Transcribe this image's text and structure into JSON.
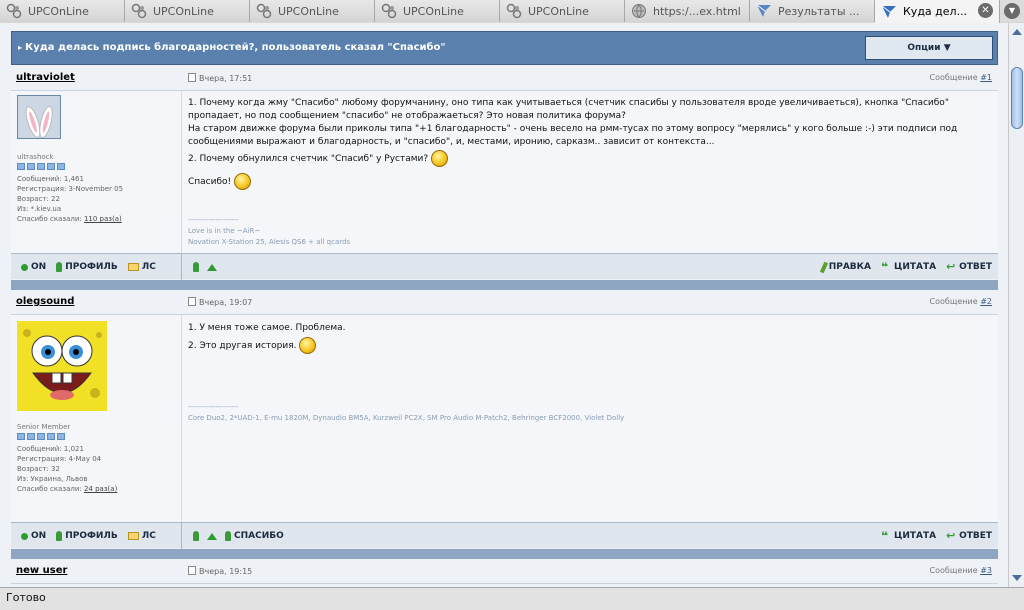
{
  "tabs": [
    {
      "label": "UPCOnLine",
      "icon": "upc-icon",
      "active": false
    },
    {
      "label": "UPCOnLine",
      "icon": "upc-icon",
      "active": false
    },
    {
      "label": "UPCOnLine",
      "icon": "upc-icon",
      "active": false
    },
    {
      "label": "UPCOnLine",
      "icon": "upc-icon",
      "active": false
    },
    {
      "label": "UPCOnLine",
      "icon": "upc-icon",
      "active": false
    },
    {
      "label": "https:/...ex.html",
      "icon": "globe-icon",
      "active": false
    },
    {
      "label": "Результаты ...",
      "icon": "forum-icon",
      "active": false
    },
    {
      "label": "Куда дел...",
      "icon": "forum-icon",
      "active": true
    }
  ],
  "topic": {
    "title": "Куда делась подпись благодарностей?, пользователь сказал \"Спасибо\"",
    "options_label": "Опции"
  },
  "posts": [
    {
      "author": "ultraviolet",
      "date": "Вчера, 17:51",
      "num_prefix": "Сообщение ",
      "num": "#1",
      "rank": "ultrashock",
      "stats": {
        "messages": "Сообщений: 1,461",
        "registered": "Регистрация: 3-November 05",
        "age": "Возраст: 22",
        "from": "Из: *.kiev.ua",
        "thanks_label": "Спасибо сказали: ",
        "thanks_link": "110 раз(а)"
      },
      "text": [
        "1. Почему когда жму \"Спасибо\" любому форумчанину, оно типа как учитываеться (счетчик спасибы у пользователя вроде увеличиваеться), кнопка \"Спасибо\" пропадает, но под сообщением \"спасибо\" не отображаеться? Это новая политика форума?",
        "На старом движке форума были приколы типа \"+1 благодарность\" - очень весело на рмм-тусах по этому вопросу \"мерялись\" у кого больше :-) эти подписи под сообщениями выражают и благодарность, и \"спасибо\", и, местами, иронию, сарказм.. зависит от контекста...",
        "2. Почему обнулился счетчик \"Спасиб\" у Рустами?",
        "Спасибо!"
      ],
      "sig": [
        "--------------------",
        "Love is in the ~AiR~",
        "Novation X-Station 25, Alesis QS6 + all qcards"
      ]
    },
    {
      "author": "olegsound",
      "date": "Вчера, 19:07",
      "num_prefix": "Сообщение ",
      "num": "#2",
      "rank": "Senior Member",
      "stats": {
        "messages": "Сообщений: 1,021",
        "registered": "Регистрация: 4-May 04",
        "age": "Возраст: 32",
        "from": "Из: Украина, Львов",
        "thanks_label": "Спасибо сказали: ",
        "thanks_link": "24 раз(а)"
      },
      "text": [
        "1. У меня тоже самое. Проблема.",
        "2. Это другая история."
      ],
      "sig": [
        "--------------------",
        "Core Duo2, 2*UAD-1, E-mu 1820M, Dynaudio BM5A, Kurzweil PC2X, SM Pro Audio M-Patch2, Behringer BCF2000, Violet Dolly"
      ]
    },
    {
      "author": "new user",
      "date": "Вчера, 19:15",
      "num_prefix": "Сообщение ",
      "num": "#3"
    }
  ],
  "footer": {
    "on": "ON",
    "profile": "ПРОФИЛЬ",
    "pm": "ЛС",
    "edit": "ПРАВКА",
    "quote": "ЦИТАТА",
    "reply": "ОТВЕТ",
    "thanks": "СПАСИБО"
  },
  "status": "Готово"
}
